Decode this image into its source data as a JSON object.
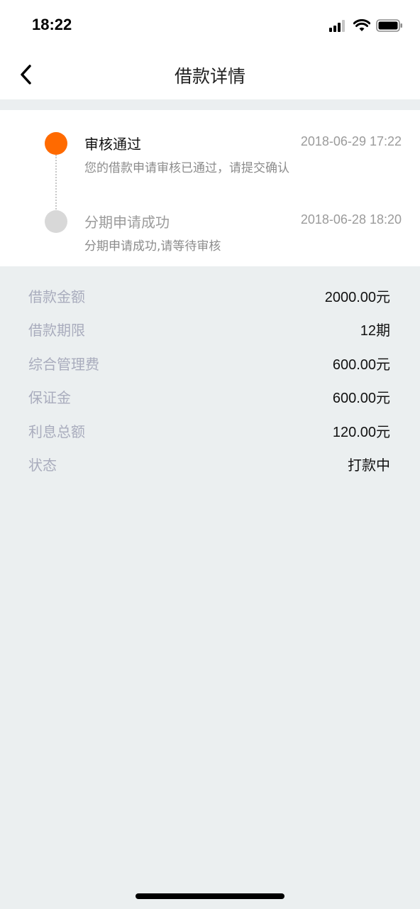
{
  "status_bar": {
    "time": "18:22"
  },
  "header": {
    "title": "借款详情"
  },
  "timeline": [
    {
      "title": "审核通过",
      "time": "2018-06-29 17:22",
      "desc": "您的借款申请审核已通过，请提交确认",
      "active": true
    },
    {
      "title": "分期申请成功",
      "time": "2018-06-28 18:20",
      "desc": "分期申请成功,请等待审核",
      "active": false
    }
  ],
  "details": [
    {
      "label": "借款金额",
      "value": "2000.00元"
    },
    {
      "label": "借款期限",
      "value": "12期"
    },
    {
      "label": "综合管理费",
      "value": "600.00元"
    },
    {
      "label": "保证金",
      "value": "600.00元"
    },
    {
      "label": "利息总额",
      "value": "120.00元"
    },
    {
      "label": "状态",
      "value": "打款中"
    }
  ],
  "colors": {
    "active_dot": "#ff6a00",
    "inactive_dot": "#d8d8d8",
    "page_bg": "#ebeff0"
  },
  "icons": {
    "back": "chevron-left-icon",
    "signal": "signal-icon",
    "wifi": "wifi-icon",
    "battery": "battery-icon"
  }
}
